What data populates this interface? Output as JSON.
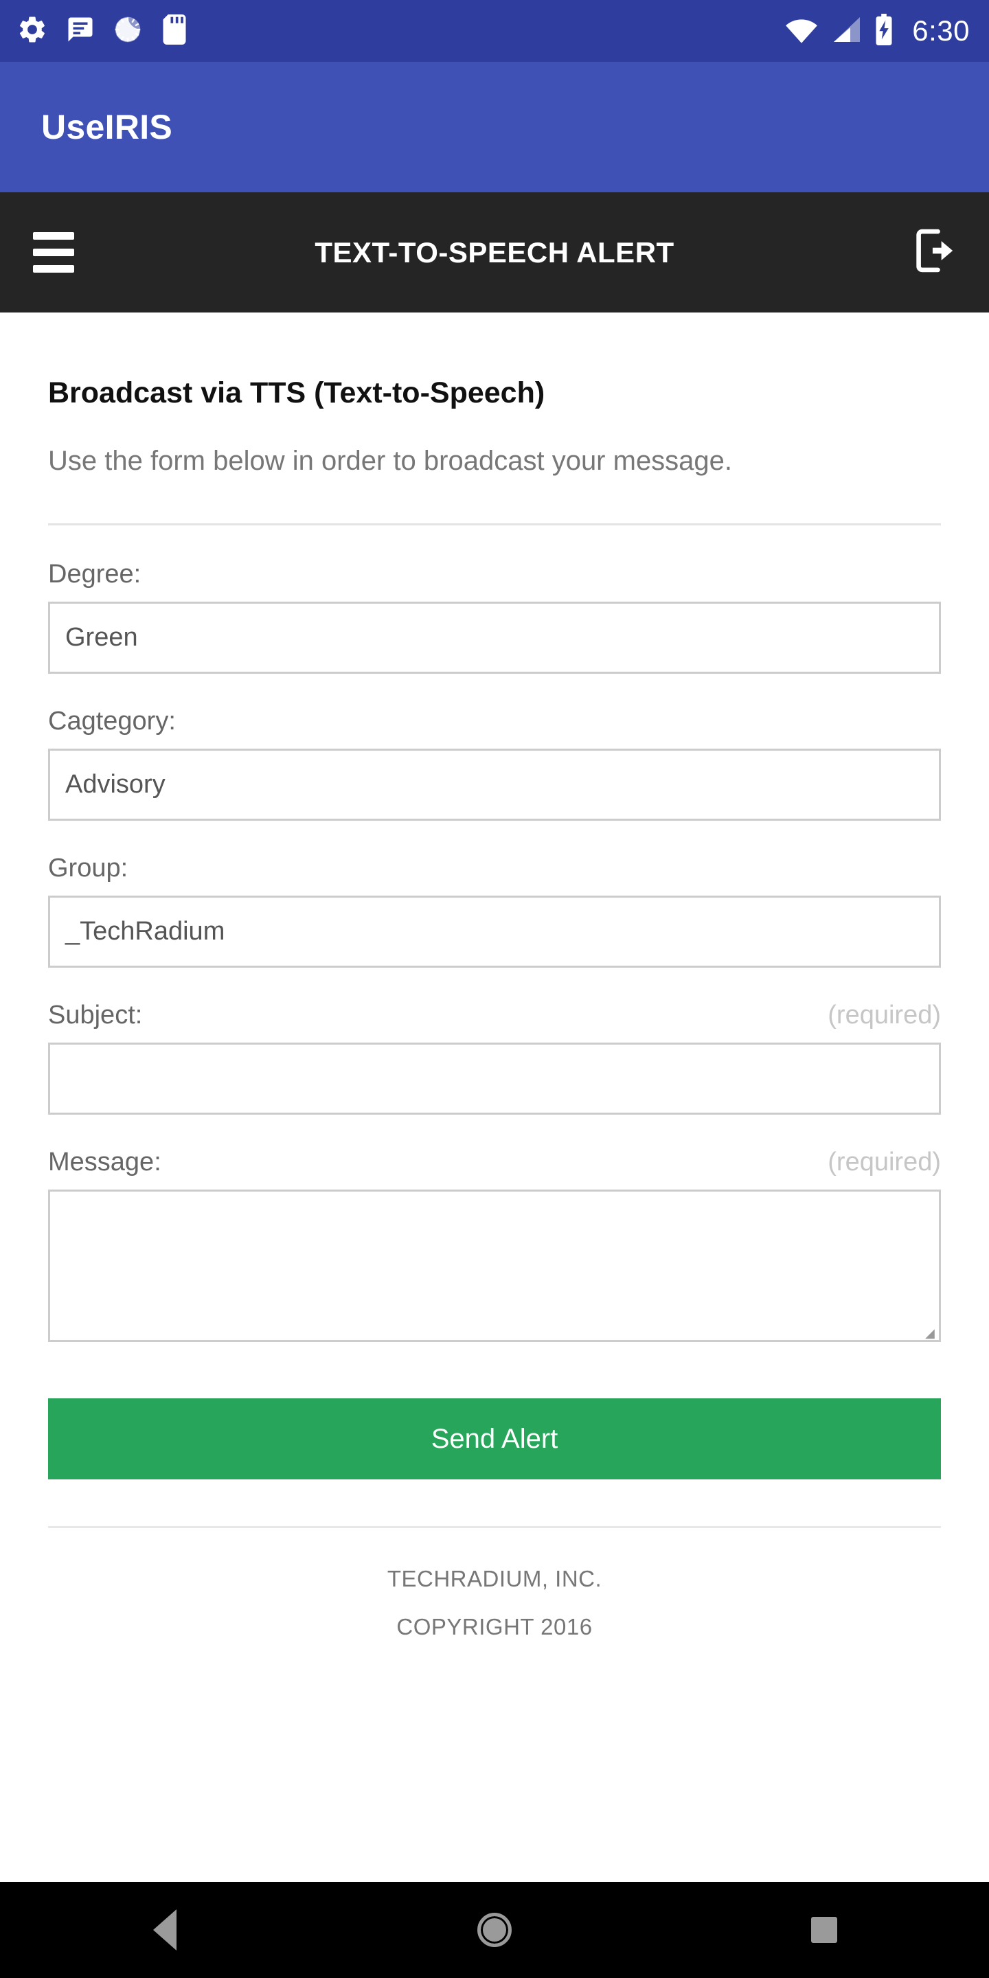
{
  "statusbar": {
    "time": "6:30",
    "left_icons": [
      "settings-gear-icon",
      "message-icon",
      "loading-spinner-icon",
      "sd-card-icon"
    ],
    "right_icons": [
      "wifi-icon",
      "cellular-signal-icon",
      "battery-charging-icon"
    ],
    "background_color": "#2F3E9E"
  },
  "appbar": {
    "title": "UseIRIS",
    "background_color": "#3F51B5"
  },
  "toolbar": {
    "title": "TEXT-TO-SPEECH ALERT",
    "menu_icon": "hamburger-menu-icon",
    "logout_icon": "logout-icon",
    "background_color": "#252525"
  },
  "page": {
    "heading": "Broadcast via TTS (Text-to-Speech)",
    "subtitle": "Use the form below in order to broadcast your message."
  },
  "form": {
    "fields": [
      {
        "label": "Degree:",
        "value": "Green",
        "required_note": "",
        "type": "select"
      },
      {
        "label": "Cagtegory:",
        "value": "Advisory",
        "required_note": "",
        "type": "select"
      },
      {
        "label": "Group:",
        "value": "_TechRadium",
        "required_note": "",
        "type": "select"
      },
      {
        "label": "Subject:",
        "value": "",
        "required_note": "(required)",
        "type": "text"
      },
      {
        "label": "Message:",
        "value": "",
        "required_note": "(required)",
        "type": "textarea"
      }
    ],
    "submit_label": "Send Alert",
    "submit_color": "#27A65B"
  },
  "footer": {
    "company": "TECHRADIUM, INC.",
    "copyright": "COPYRIGHT 2016"
  },
  "navbar": {
    "back": "back-icon",
    "home": "home-icon",
    "recents": "recents-icon"
  }
}
